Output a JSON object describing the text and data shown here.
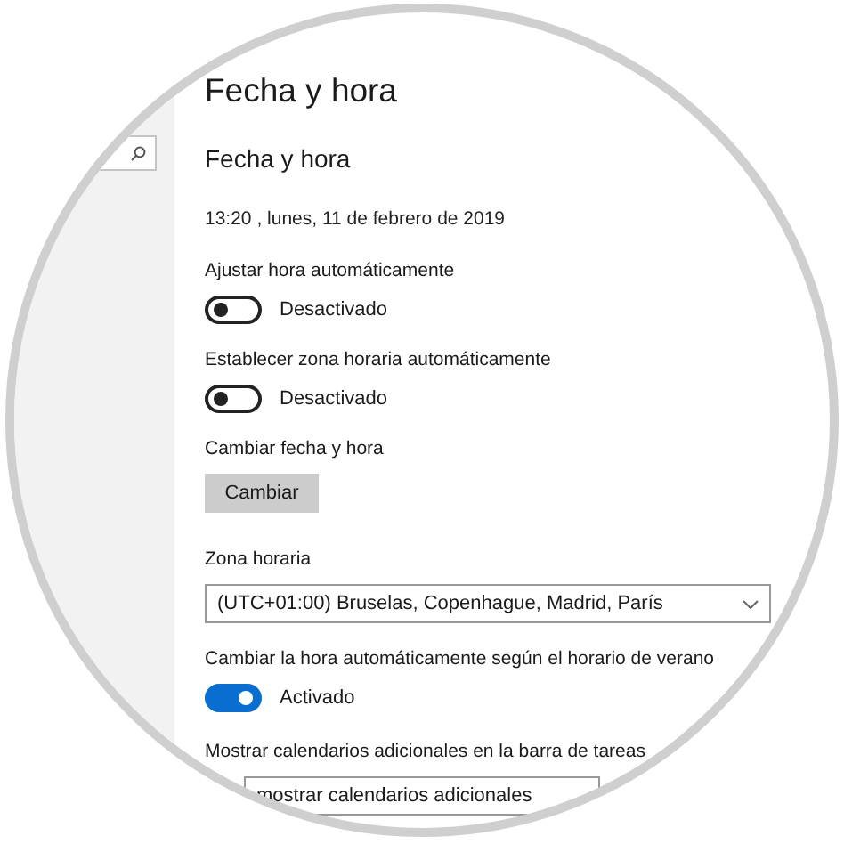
{
  "page_title": "Fecha y hora",
  "section_title": "Fecha y hora",
  "current_datetime": "13:20 , lunes, 11 de febrero de 2019",
  "settings": [
    {
      "kind": "toggle",
      "label": "Ajustar hora automáticamente",
      "on": false,
      "state_text": "Desactivado"
    },
    {
      "kind": "toggle",
      "label": "Establecer zona horaria automáticamente",
      "on": false,
      "state_text": "Desactivado"
    },
    {
      "kind": "button",
      "label": "Cambiar fecha y hora",
      "button": "Cambiar"
    },
    {
      "kind": "dropdown",
      "label": "Zona horaria",
      "value": "(UTC+01:00) Bruselas, Copenhague, Madrid, París"
    },
    {
      "kind": "toggle",
      "label": "Cambiar la hora automáticamente según el horario de verano",
      "on": true,
      "state_text": "Activado"
    },
    {
      "kind": "dropdown",
      "label": "Mostrar calendarios adicionales en la barra de tareas",
      "value": "mostrar calendarios adicionales"
    }
  ]
}
